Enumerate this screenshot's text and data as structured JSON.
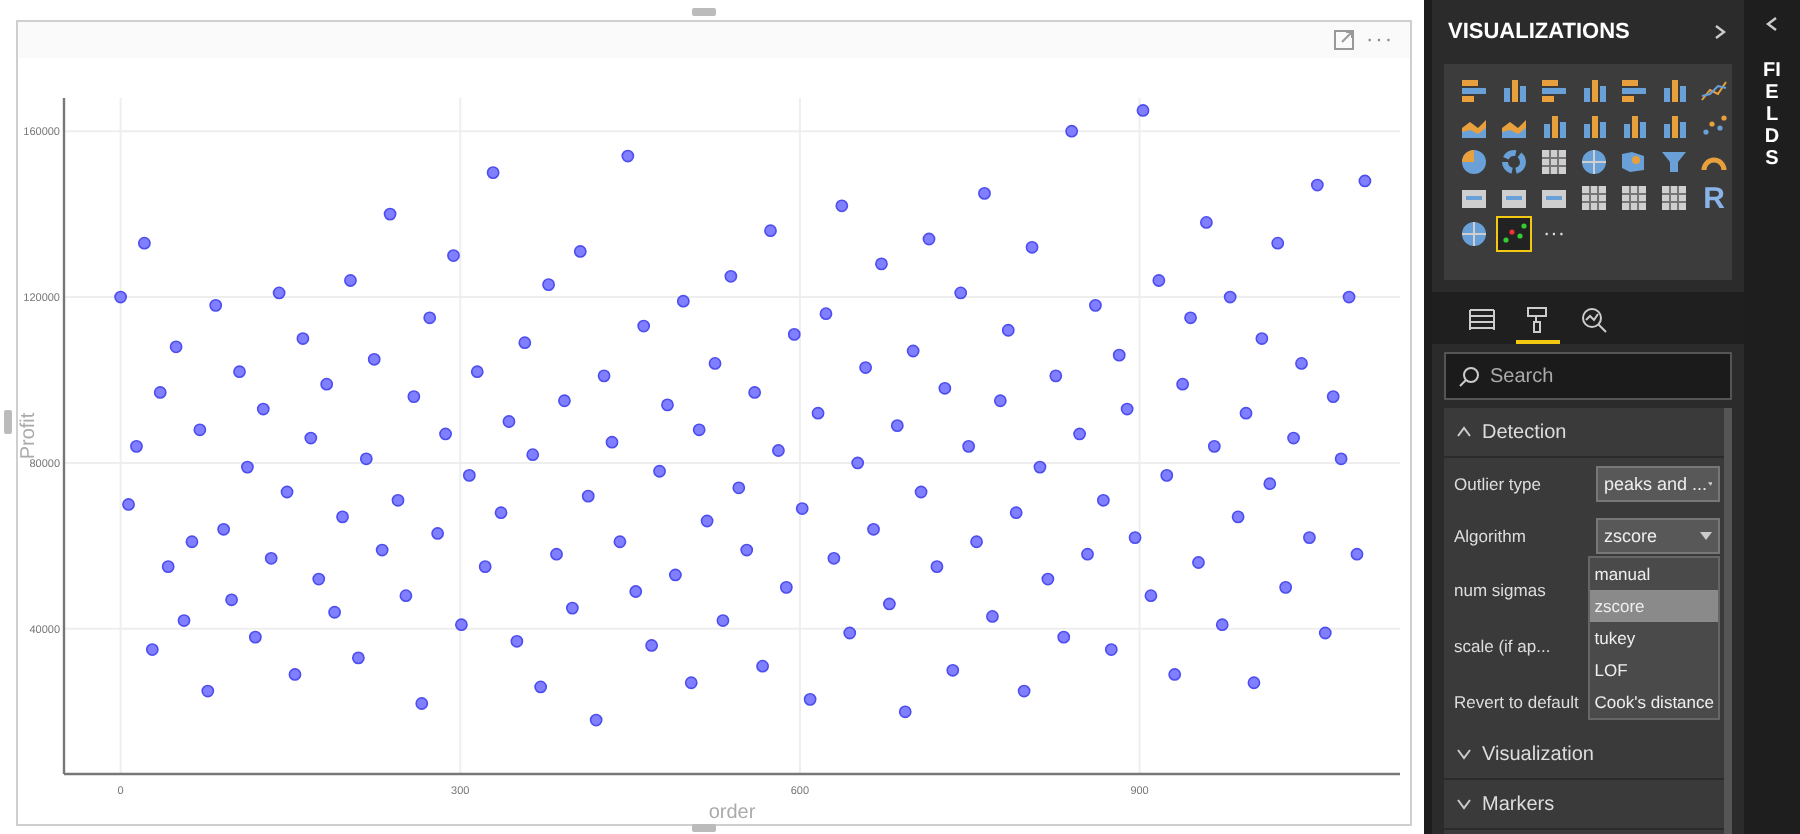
{
  "visual": {
    "more": "···",
    "chart_data": {
      "type": "scatter",
      "xlabel": "order",
      "ylabel": "Profit",
      "xlim": [
        -50,
        1130
      ],
      "ylim": [
        5000,
        168000
      ],
      "xticks": [
        0,
        300,
        600,
        900
      ],
      "yticks": [
        40000,
        80000,
        120000,
        160000
      ],
      "x": [
        0,
        7,
        14,
        21,
        28,
        35,
        42,
        49,
        56,
        63,
        70,
        77,
        84,
        91,
        98,
        105,
        112,
        119,
        126,
        133,
        140,
        147,
        154,
        161,
        168,
        175,
        182,
        189,
        196,
        203,
        210,
        217,
        224,
        231,
        238,
        245,
        252,
        259,
        266,
        273,
        280,
        287,
        294,
        301,
        308,
        315,
        322,
        329,
        336,
        343,
        350,
        357,
        364,
        371,
        378,
        385,
        392,
        399,
        406,
        413,
        420,
        427,
        434,
        441,
        448,
        455,
        462,
        469,
        476,
        483,
        490,
        497,
        504,
        511,
        518,
        525,
        532,
        539,
        546,
        553,
        560,
        567,
        574,
        581,
        588,
        595,
        602,
        609,
        616,
        623,
        630,
        637,
        644,
        651,
        658,
        665,
        672,
        679,
        686,
        693,
        700,
        707,
        714,
        721,
        728,
        735,
        742,
        749,
        756,
        763,
        770,
        777,
        784,
        791,
        798,
        805,
        812,
        819,
        826,
        833,
        840,
        847,
        854,
        861,
        868,
        875,
        882,
        889,
        896,
        903,
        910,
        917,
        924,
        931,
        938,
        945,
        952,
        959,
        966,
        973,
        980,
        987,
        994,
        1001,
        1008,
        1015,
        1022,
        1029,
        1036,
        1043,
        1050,
        1057,
        1064,
        1071,
        1078,
        1085,
        1092,
        1099
      ],
      "grid": true,
      "series": [
        {
          "color": "#7f7fff",
          "values": [
            120000,
            70000,
            84000,
            133000,
            35000,
            97000,
            55000,
            108000,
            42000,
            61000,
            88000,
            25000,
            118000,
            64000,
            47000,
            102000,
            79000,
            38000,
            93000,
            57000,
            121000,
            73000,
            29000,
            110000,
            86000,
            52000,
            99000,
            44000,
            67000,
            124000,
            33000,
            81000,
            105000,
            59000,
            140000,
            71000,
            48000,
            96000,
            22000,
            115000,
            63000,
            87000,
            130000,
            41000,
            77000,
            102000,
            55000,
            150000,
            68000,
            90000,
            37000,
            109000,
            82000,
            26000,
            123000,
            58000,
            95000,
            45000,
            131000,
            72000,
            18000,
            101000,
            85000,
            61000,
            154000,
            49000,
            113000,
            36000,
            78000,
            94000,
            53000,
            119000,
            27000,
            88000,
            66000,
            104000,
            42000,
            125000,
            74000,
            59000,
            97000,
            31000,
            136000,
            83000,
            50000,
            111000,
            69000,
            23000,
            92000,
            116000,
            57000,
            142000,
            39000,
            80000,
            103000,
            64000,
            128000,
            46000,
            89000,
            20000,
            107000,
            73000,
            134000,
            55000,
            98000,
            30000,
            121000,
            84000,
            61000,
            145000,
            43000,
            95000,
            112000,
            68000,
            25000,
            132000,
            79000,
            52000,
            101000,
            38000,
            160000,
            87000,
            58000,
            118000,
            71000,
            35000,
            106000,
            93000,
            62000,
            165000,
            48000,
            124000,
            77000,
            29000,
            99000,
            115000,
            56000,
            138000,
            84000,
            41000,
            120000,
            67000,
            92000,
            27000,
            110000,
            75000,
            133000,
            50000,
            86000,
            104000,
            62000,
            147000,
            39000,
            96000,
            81000,
            120000,
            58000,
            148000
          ]
        }
      ]
    }
  },
  "pane": {
    "title": "VISUALIZATIONS",
    "gallery": [
      {
        "selected": false
      },
      {
        "selected": false
      },
      {
        "selected": false
      },
      {
        "selected": false
      },
      {
        "selected": false
      },
      {
        "selected": false
      },
      {
        "selected": false
      },
      {
        "selected": false
      },
      {
        "selected": false
      },
      {
        "selected": false
      },
      {
        "selected": false
      },
      {
        "selected": false
      },
      {
        "selected": false
      },
      {
        "selected": false
      },
      {
        "selected": false
      },
      {
        "selected": false
      },
      {
        "selected": false
      },
      {
        "selected": false
      },
      {
        "selected": false
      },
      {
        "selected": false
      },
      {
        "selected": false
      },
      {
        "selected": false
      },
      {
        "selected": false
      },
      {
        "selected": false
      },
      {
        "selected": false
      },
      {
        "selected": false
      },
      {
        "selected": false
      },
      {
        "selected": false,
        "glyph": "R"
      },
      {
        "selected": false
      },
      {
        "selected": true
      }
    ],
    "gallery_more": "···",
    "tabs": [
      {
        "selected": false
      },
      {
        "selected": true
      },
      {
        "selected": false
      }
    ],
    "search": {
      "placeholder": "Search"
    },
    "sections": [
      {
        "title": "Detection",
        "expanded": true,
        "rows": [
          {
            "kind": "dropdown",
            "label": "Outlier type",
            "value": "peaks and ..."
          },
          {
            "kind": "dropdown",
            "label": "Algorithm",
            "value": "zscore",
            "open": true,
            "options": [
              {
                "label": "manual",
                "selected": false
              },
              {
                "label": "zscore",
                "selected": true
              },
              {
                "label": "tukey",
                "selected": false
              },
              {
                "label": "LOF",
                "selected": false
              },
              {
                "label": "Cook's distance",
                "selected": false
              }
            ]
          },
          {
            "kind": "text",
            "label": "num sigmas"
          },
          {
            "kind": "text",
            "label": "scale (if ap..."
          },
          {
            "kind": "text",
            "label": "Revert to default"
          }
        ]
      },
      {
        "title": "Visualization",
        "expanded": false
      },
      {
        "title": "Markers",
        "expanded": false
      }
    ]
  },
  "fields": {
    "title": "FIELDS"
  }
}
